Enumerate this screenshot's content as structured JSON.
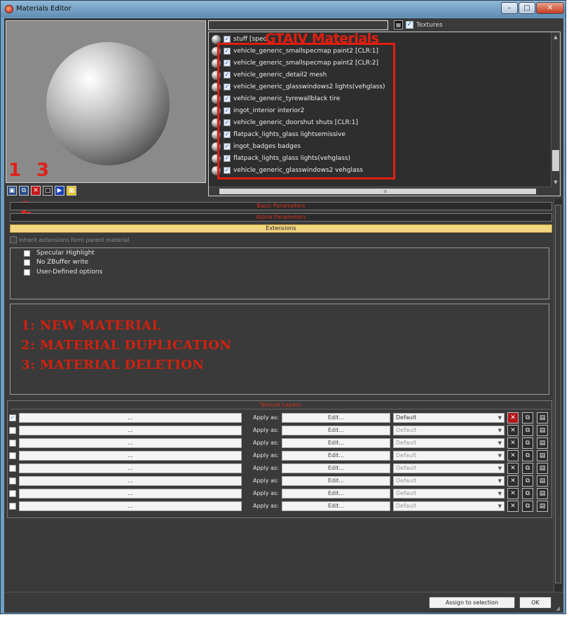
{
  "window": {
    "title": "Materials Editor"
  },
  "preview": {
    "annotations": [
      "1",
      "3",
      "2"
    ]
  },
  "toolbar": {
    "buttons": [
      {
        "name": "new-material-button",
        "icon": "new-material-icon",
        "color": "#2a4c8a"
      },
      {
        "name": "duplicate-material-button",
        "icon": "duplicate-icon",
        "color": "#2a4c8a"
      },
      {
        "name": "delete-material-button",
        "icon": "delete-icon",
        "color": "#c8161a"
      },
      {
        "name": "material-settings-button",
        "icon": "window-icon",
        "color": "#2b2b2b"
      },
      {
        "name": "assign-material-button",
        "icon": "arrow-icon",
        "color": "#1a3fb0"
      },
      {
        "name": "texture-checker-button",
        "icon": "checker-icon",
        "color": "#e0c020"
      }
    ]
  },
  "textures_toggle": {
    "label": "Textures",
    "checked": true
  },
  "annotation_title": "GTAIV Materials",
  "materials": [
    {
      "name": "stuff [spec",
      "checked": true
    },
    {
      "name": "vehicle_generic_smallspecmap paint2 [CLR:1]",
      "checked": true
    },
    {
      "name": "vehicle_generic_smallspecmap paint2 [CLR:2]",
      "checked": true
    },
    {
      "name": "vehicle_generic_detail2 mesh",
      "checked": true
    },
    {
      "name": "vehicle_generic_glasswindows2 lights(vehglass)",
      "checked": true
    },
    {
      "name": "vehicle_generic_tyrewallblack tire",
      "checked": true
    },
    {
      "name": "ingot_interior interior2",
      "checked": true
    },
    {
      "name": "vehicle_generic_doorshut shuts [CLR:1]",
      "checked": true
    },
    {
      "name": "flatpack_lights_glass lightsemissive",
      "checked": true
    },
    {
      "name": "ingot_badges badges",
      "checked": true
    },
    {
      "name": "flatpack_lights_glass lights(vehglass)",
      "checked": true
    },
    {
      "name": "vehicle_generic_glasswindows2 vehglass",
      "checked": true
    }
  ],
  "rollouts": {
    "basic": "Basic Parameters",
    "alpha": "Alpha Parameters",
    "extensions": "Extensions"
  },
  "extensions": {
    "inherit_label": "Inherit extensions form parent material",
    "options": [
      "Specular Highlight",
      "No ZBuffer write",
      "User-Defined options"
    ]
  },
  "notes": [
    "1: NEW MATERIAL",
    "2: MATERIAL DUPLICATION",
    "3: MATERIAL DELETION"
  ],
  "texture_layers": {
    "title": "Texture Layers",
    "map_placeholder": "...",
    "apply_label": "Apply as:",
    "edit_label": "Edit...",
    "select_value": "Default",
    "rows": [
      {
        "checked": true,
        "active": true
      },
      {
        "checked": false,
        "active": false
      },
      {
        "checked": false,
        "active": false
      },
      {
        "checked": false,
        "active": false
      },
      {
        "checked": false,
        "active": false
      },
      {
        "checked": false,
        "active": false
      },
      {
        "checked": false,
        "active": false
      },
      {
        "checked": false,
        "active": false
      }
    ]
  },
  "footer": {
    "assign_label": "Assign to selection",
    "ok_label": "OK"
  },
  "colors": {
    "annotation_red": "#e21e10",
    "rollout_open": "#f3d47f"
  }
}
